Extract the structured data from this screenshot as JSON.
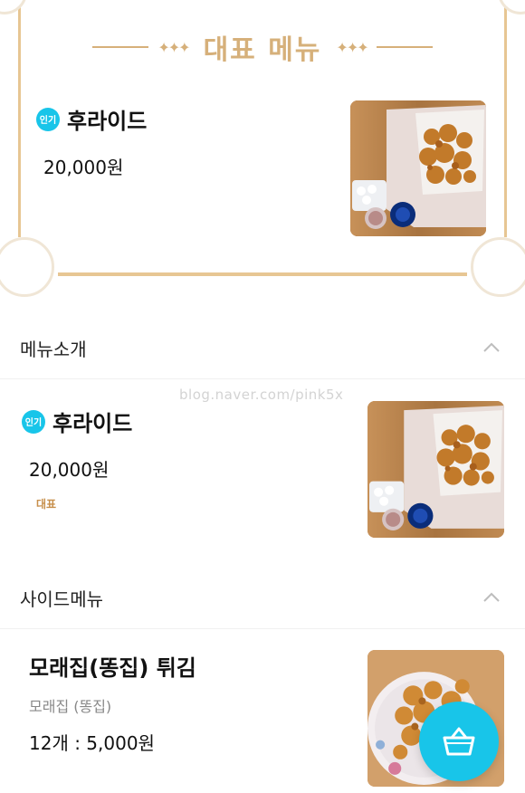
{
  "featured": {
    "title": "대표 메뉴",
    "badge": "인기",
    "item": {
      "name": "후라이드",
      "price": "20,000원"
    }
  },
  "sections": [
    {
      "header": "메뉴소개",
      "items": [
        {
          "badge": "인기",
          "name": "후라이드",
          "price": "20,000원",
          "tag": "대표"
        }
      ]
    },
    {
      "header": "사이드메뉴",
      "items": [
        {
          "name": "모래집(똥집) 튀김",
          "subtitle": "모래집 (똥집)",
          "price": "12개 : 5,000원"
        }
      ]
    }
  ],
  "watermark": "blog.naver.com/pink5x",
  "colors": {
    "accent": "#18c5e9",
    "gold": "#d6b07a",
    "tag": "#c78f4b"
  },
  "icons": {
    "cart": "basket-icon",
    "collapse": "chevron-up-icon"
  }
}
